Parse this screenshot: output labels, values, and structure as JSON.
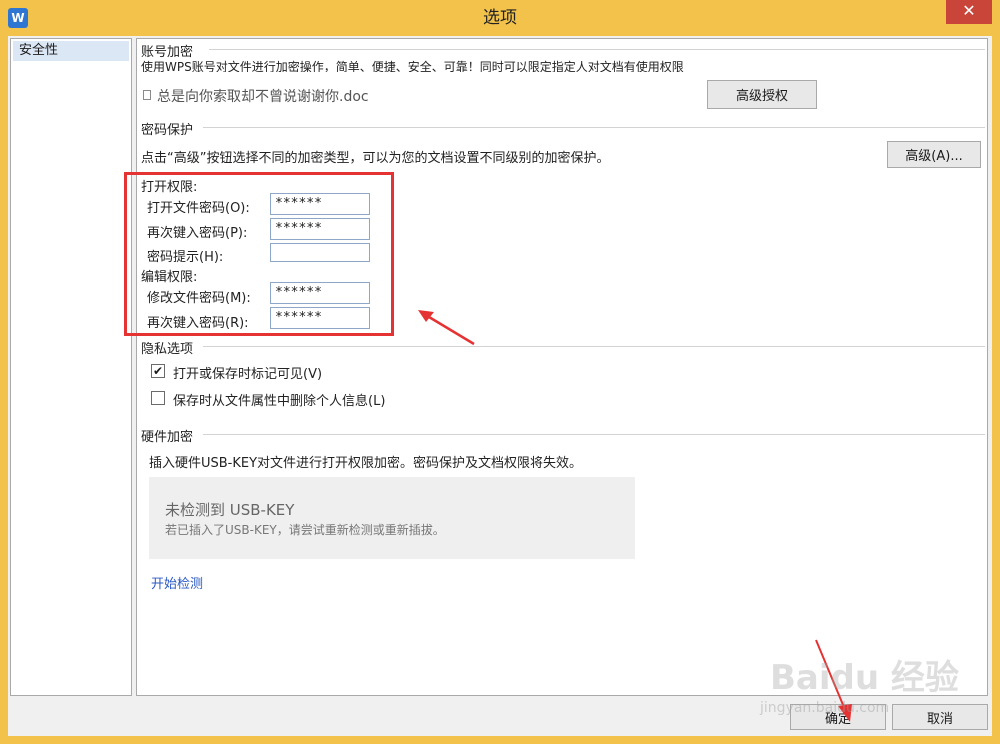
{
  "window": {
    "app_icon": "W",
    "title": "选项",
    "close_glyph": "✕"
  },
  "sidebar": {
    "items": [
      {
        "label": "安全性"
      }
    ]
  },
  "account": {
    "section_title": "账号加密",
    "description": "使用WPS账号对文件进行加密操作，简单、便捷、安全、可靠！同时可以限定指定人对文档有使用权限",
    "doc_name": "总是向你索取却不曾说谢谢你.doc",
    "advanced_auth_label": "高级授权"
  },
  "password": {
    "section_title": "密码保护",
    "description": "点击“高级”按钮选择不同的加密类型，可以为您的文档设置不同级别的加密保护。",
    "advanced_label": "高级(A)...",
    "open_group_label": "打开权限:",
    "open_password_label": "打开文件密码(O):",
    "open_password_value": "******",
    "open_confirm_label": "再次键入密码(P):",
    "open_confirm_value": "******",
    "hint_label": "密码提示(H):",
    "hint_value": "",
    "edit_group_label": "编辑权限:",
    "edit_password_label": "修改文件密码(M):",
    "edit_password_value": "******",
    "edit_confirm_label": "再次键入密码(R):",
    "edit_confirm_value": "******"
  },
  "privacy": {
    "section_title": "隐私选项",
    "options": [
      {
        "label": "打开或保存时标记可见(V)",
        "checked": true,
        "glyph": "✔"
      },
      {
        "label": "保存时从文件属性中删除个人信息(L)",
        "checked": false,
        "glyph": ""
      }
    ]
  },
  "hardware": {
    "section_title": "硬件加密",
    "description": "插入硬件USB-KEY对文件进行打开权限加密。密码保护及文档权限将失效。",
    "status_title": "未检测到 USB-KEY",
    "status_hint": "若已插入了USB-KEY，请尝试重新检测或重新插拔。",
    "start_detect_label": "开始检测"
  },
  "footer": {
    "ok_label": "确定",
    "cancel_label": "取消"
  },
  "watermark": {
    "brand": "Baidu 经验",
    "url": "jingyan.baidu.com"
  },
  "colors": {
    "titlebar": "#f2c24a",
    "close_button": "#c9453a",
    "highlight_box": "#e53333",
    "link": "#2b59c3",
    "selected_item": "#dce7f5"
  },
  "icons": {
    "app": "wps-app-icon",
    "document": "document-icon",
    "close": "close-icon",
    "checkmark": "checkmark-icon"
  }
}
